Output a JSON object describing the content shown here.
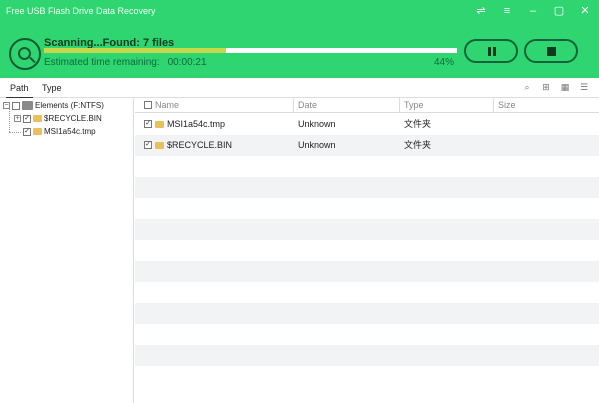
{
  "window": {
    "title": "Free USB Flash Drive Data Recovery",
    "controls": [
      "pin-icon",
      "menu-icon",
      "minimize-icon",
      "maximize-icon",
      "close-icon"
    ],
    "control_glyphs": [
      "⇌",
      "≡",
      "–",
      "▢",
      "✕"
    ]
  },
  "scan": {
    "status": "Scanning...Found: 7 files",
    "eta_label": "Estimated time remaining:",
    "eta_value": "00:00:21",
    "percent_text": "44%",
    "progress": 0.44
  },
  "tabs": [
    {
      "label": "Path",
      "active": true
    },
    {
      "label": "Type",
      "active": false
    }
  ],
  "tree": {
    "root": {
      "label": "Elements (F:NTFS)"
    },
    "children": [
      {
        "label": "$RECYCLE.BIN"
      },
      {
        "label": "MSI1a54c.tmp"
      }
    ]
  },
  "list": {
    "columns": [
      "Name",
      "Date",
      "Type",
      "Size"
    ],
    "rows": [
      {
        "name": "MSI1a54c.tmp",
        "date": "Unknown",
        "type": "文件夹",
        "size": ""
      },
      {
        "name": "$RECYCLE.BIN",
        "date": "Unknown",
        "type": "文件夹",
        "size": ""
      }
    ]
  },
  "colors": {
    "header": "#2fd571",
    "progress_fill": "#c6d94a",
    "row_alt": "#f2f3f5"
  }
}
